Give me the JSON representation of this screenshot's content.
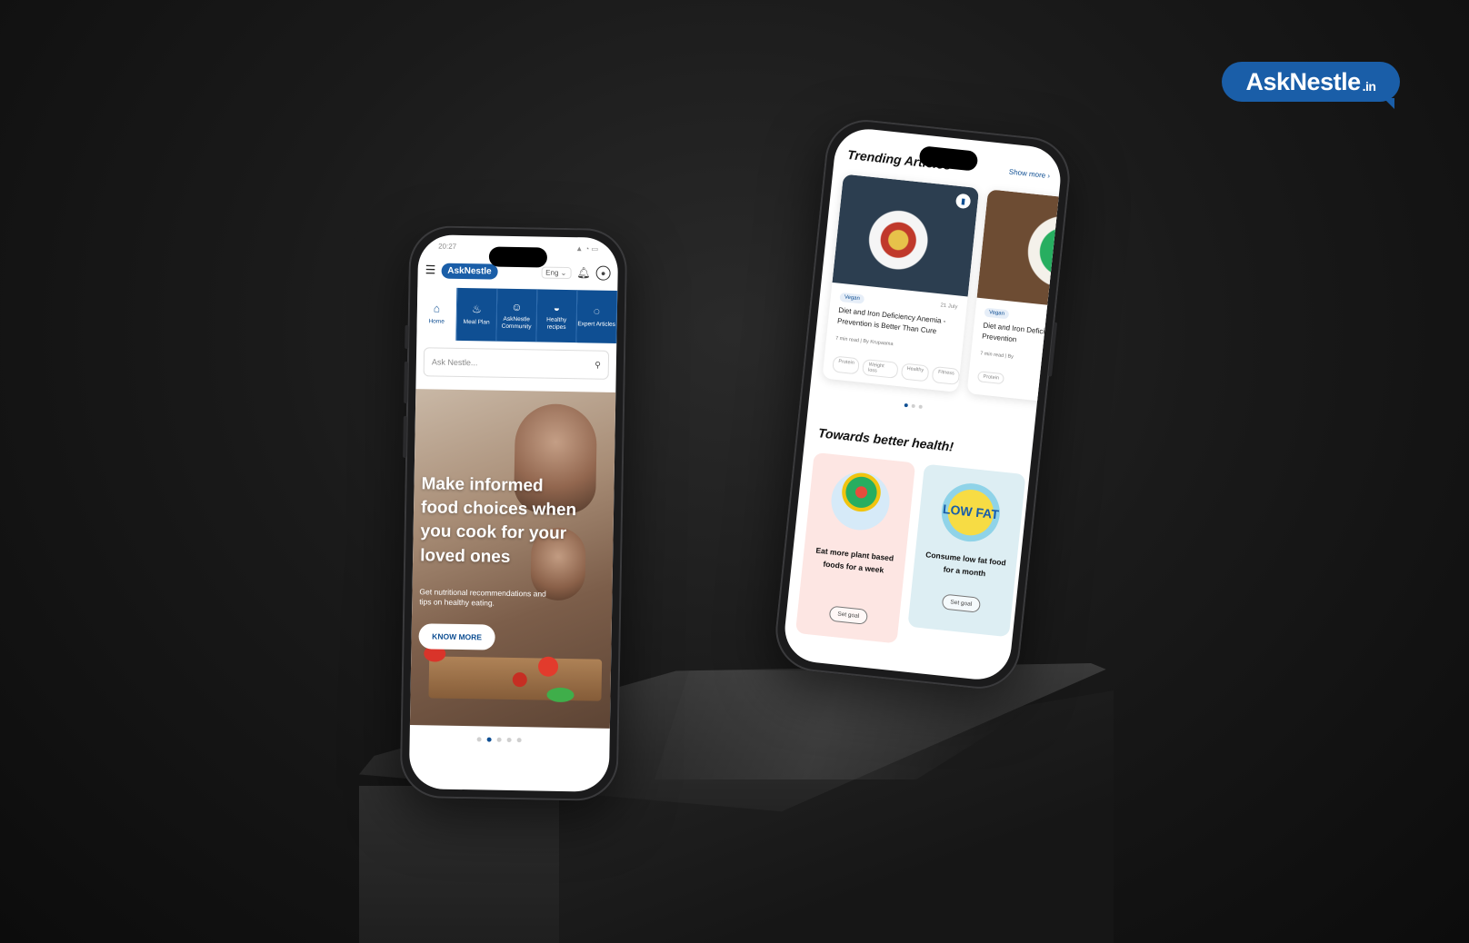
{
  "brand": {
    "name": "AskNestle",
    "suffix": ".in"
  },
  "left_phone": {
    "status": {
      "time": "20:27"
    },
    "header": {
      "logo": "AskNestle",
      "language": "Eng"
    },
    "nav_tabs": [
      {
        "label": "Home",
        "icon": "home-icon"
      },
      {
        "label": "Meal Plan",
        "icon": "meal-plan-icon"
      },
      {
        "label": "AskNestle Community",
        "icon": "community-icon"
      },
      {
        "label": "Healthy recipes",
        "icon": "recipes-icon"
      },
      {
        "label": "Expert Articles",
        "icon": "articles-icon"
      }
    ],
    "search": {
      "placeholder": "Ask Nestle..."
    },
    "hero": {
      "headline": "Make informed food choices when you cook for your loved ones",
      "subtext": "Get nutritional recommendations and tips on healthy eating.",
      "button": "KNOW MORE"
    },
    "carousel": {
      "count": 5,
      "active_index": 1
    }
  },
  "right_phone": {
    "trending": {
      "title": "Trending Articles",
      "show_more": "Show more ›",
      "cards": [
        {
          "tag": "Vegan",
          "date": "21 July",
          "title": "Diet and Iron Deficiency Anemia - Prevention is Better Than Cure",
          "meta": "7 min read | By Krupaama",
          "chips": [
            "Protein",
            "Weight loss",
            "Healthy",
            "Fitness"
          ]
        },
        {
          "tag": "Vegan",
          "title": "Diet and Iron Deficiency Anemia - Prevention",
          "meta": "7 min read | By",
          "chips": [
            "Protein"
          ]
        }
      ],
      "carousel": {
        "count": 3,
        "active_index": 0
      }
    },
    "health": {
      "title": "Towards better health!",
      "goals": [
        {
          "text": "Eat more plant based foods for a week",
          "button": "Set goal",
          "color": "#fde6e3"
        },
        {
          "text": "Consume low fat food for a month",
          "button": "Set goal",
          "badge": "LOW FAT",
          "color": "#ddeef3"
        }
      ]
    }
  },
  "colors": {
    "brand_blue": "#1a5ea8",
    "nav_blue": "#0f4f93"
  }
}
